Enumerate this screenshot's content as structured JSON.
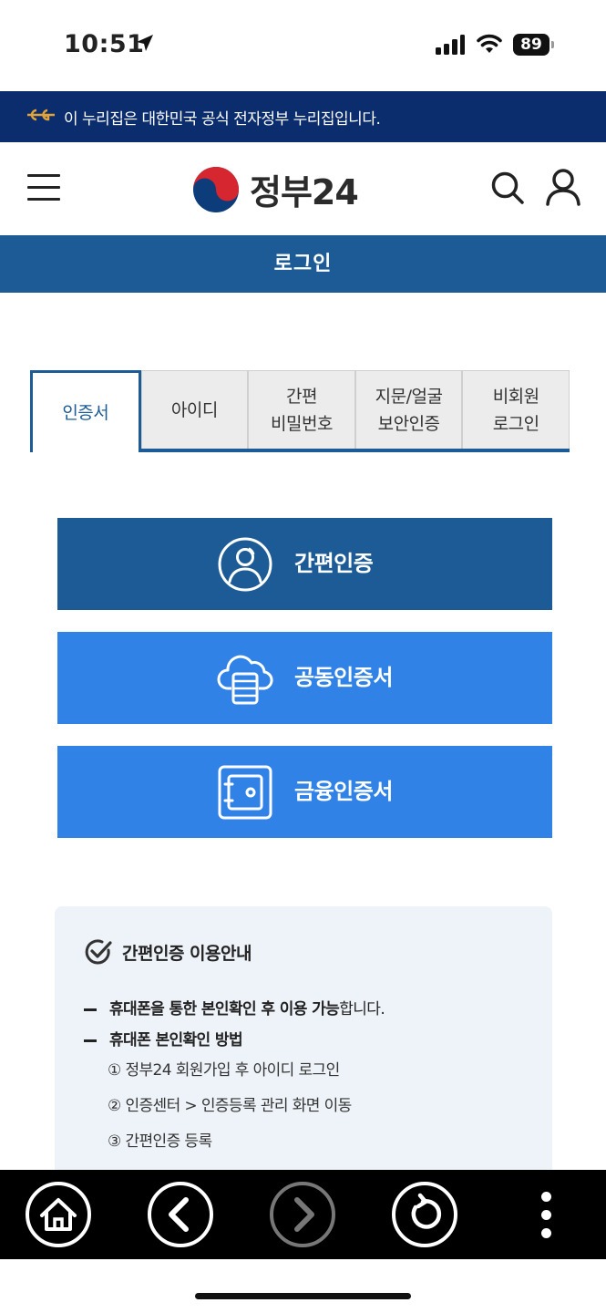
{
  "status_bar": {
    "time": "10:51",
    "battery": "89"
  },
  "banner": {
    "text": "이 누리집은 대한민국 공식 전자정부 누리집입니다."
  },
  "header": {
    "logo_text": "정부24"
  },
  "title": "로그인",
  "tabs": [
    {
      "label": "인증서",
      "active": true
    },
    {
      "label": "아이디",
      "active": false
    },
    {
      "label": "간편\n비밀번호",
      "active": false
    },
    {
      "label": "지문/얼굴\n보안인증",
      "active": false
    },
    {
      "label": "비회원\n로그인",
      "active": false
    }
  ],
  "login_buttons": {
    "simple": "간편인증",
    "joint": "공동인증서",
    "finance": "금융인증서"
  },
  "info": {
    "title": "간편인증 이용안내",
    "line1_bold": "휴대폰을 통한 본인확인 후 이용 가능",
    "line1_rest": "합니다.",
    "line2_bold": "휴대폰 본인확인 방법",
    "steps": [
      "① 정부24 회원가입 후 아이디 로그인",
      "② 인증센터 > 인증등록 관리 화면 이동",
      "③ 간편인증 등록"
    ]
  },
  "colors": {
    "banner_bg": "#0b2d6e",
    "primary": "#1d5b96",
    "button_blue": "#3182e6",
    "info_bg": "#eef3f9",
    "nav_bg": "#000000"
  },
  "icons": {
    "status": [
      "location-arrow-icon",
      "signal-icon",
      "wifi-icon",
      "battery-icon"
    ],
    "header": [
      "menu-icon",
      "search-icon",
      "user-icon"
    ],
    "buttons": [
      "person-circle-icon",
      "cloud-server-icon",
      "safe-icon"
    ],
    "nav": [
      "home-icon",
      "back-icon",
      "forward-icon",
      "refresh-icon",
      "more-icon"
    ]
  }
}
